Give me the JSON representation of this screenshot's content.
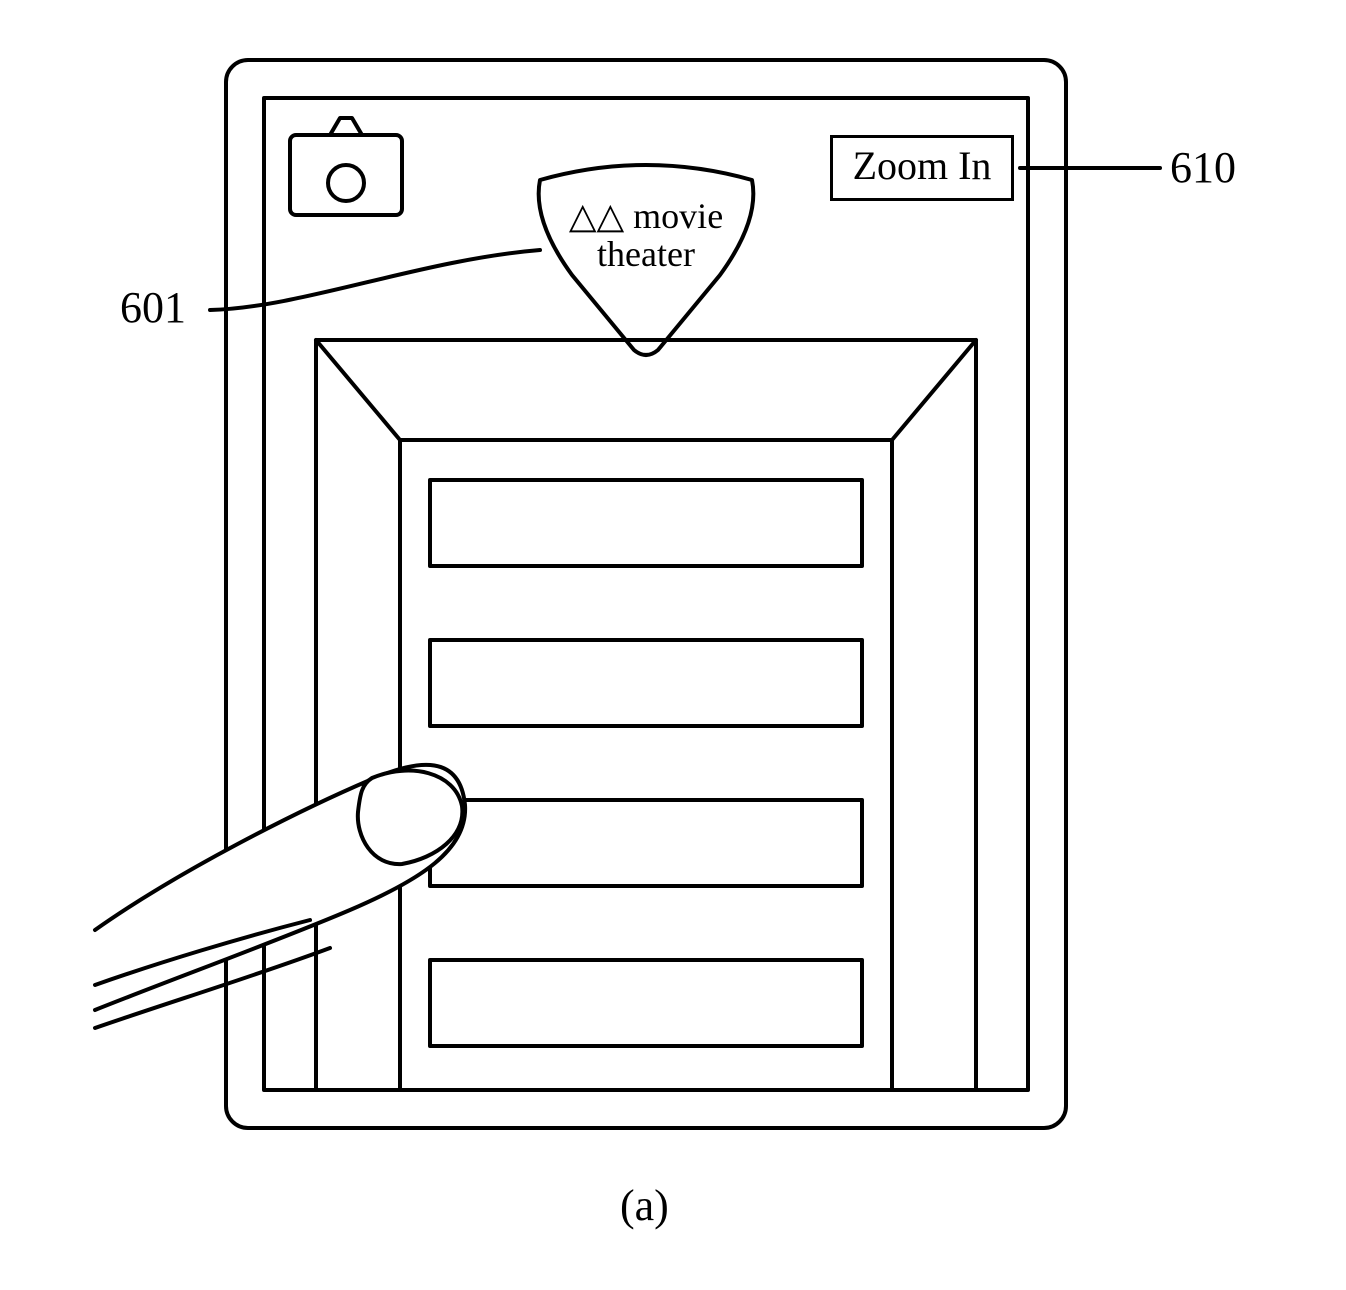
{
  "callouts": {
    "marker_ref": "601",
    "zoom_ref": "610"
  },
  "zoom_button": {
    "label": "Zoom In"
  },
  "marker": {
    "line1": "△△ movie",
    "line2": "theater"
  },
  "figure_label": "(a)"
}
